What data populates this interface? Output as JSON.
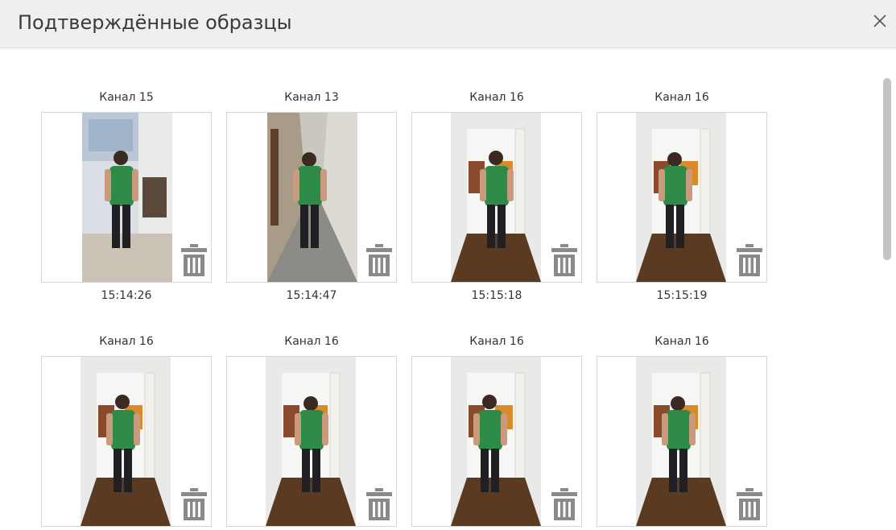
{
  "dialog": {
    "title": "Подтверждённые образцы",
    "close_icon": "close-icon"
  },
  "colors": {
    "header_bg": "#efefef",
    "shirt": "#2e8b47",
    "trash": "#8a8a8a"
  },
  "samples": [
    {
      "channel": "Канал 15",
      "time": "15:14:26",
      "scene": "office"
    },
    {
      "channel": "Канал 13",
      "time": "15:14:47",
      "scene": "corridor"
    },
    {
      "channel": "Канал 16",
      "time": "15:15:18",
      "scene": "doorway"
    },
    {
      "channel": "Канал 16",
      "time": "15:15:19",
      "scene": "doorway"
    },
    {
      "channel": "Канал 16",
      "time": "",
      "scene": "doorway"
    },
    {
      "channel": "Канал 16",
      "time": "",
      "scene": "doorway"
    },
    {
      "channel": "Канал 16",
      "time": "",
      "scene": "doorway"
    },
    {
      "channel": "Канал 16",
      "time": "",
      "scene": "doorway"
    }
  ]
}
